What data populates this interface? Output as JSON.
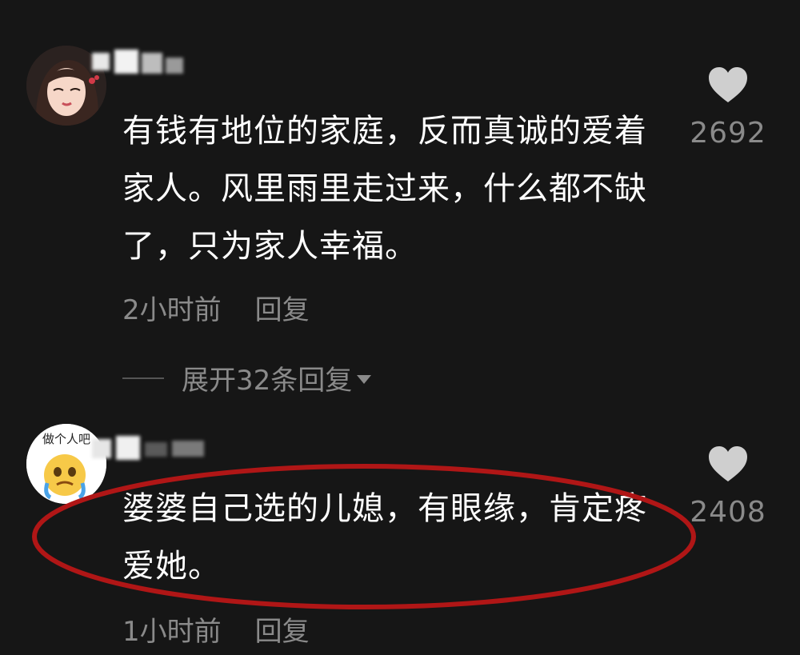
{
  "comments": [
    {
      "text": "有钱有地位的家庭，反而真诚的爱着家人。风里雨里走过来，什么都不缺了，只为家人幸福。",
      "time": "2小时前",
      "reply_label": "回复",
      "likes": "2692",
      "expand_label": "展开32条回复"
    },
    {
      "avatar_text": "做个人吧",
      "text": "婆婆自己选的儿媳，有眼缘，肯定疼爱她。",
      "time": "1小时前",
      "reply_label": "回复",
      "likes": "2408"
    }
  ],
  "colors": {
    "background": "#161616",
    "text": "#ffffff",
    "muted": "#8a8a8a",
    "heart": "#cfcfcf",
    "highlight": "#b01616"
  },
  "icons": {
    "like": "heart-icon",
    "expand": "triangle-down-icon"
  }
}
